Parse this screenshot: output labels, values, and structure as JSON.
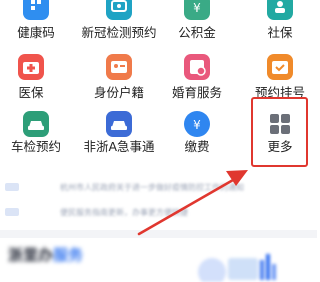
{
  "services": {
    "row1": [
      {
        "label": "健康码",
        "icon": "health-code-icon",
        "color": "#2f8ef0"
      },
      {
        "label": "新冠检测预约",
        "icon": "covid-test-icon",
        "color": "#1fa3c4"
      },
      {
        "label": "公积金",
        "icon": "housing-fund-icon",
        "color": "#3aaa86"
      },
      {
        "label": "社保",
        "icon": "social-security-icon",
        "color": "#22a9a2"
      }
    ],
    "row2": [
      {
        "label": "医保",
        "icon": "medical-insurance-icon",
        "color": "#f0544c"
      },
      {
        "label": "身份户籍",
        "icon": "id-household-icon",
        "color": "#f07a4a"
      },
      {
        "label": "婚育服务",
        "icon": "marriage-birth-icon",
        "color": "#e9587c"
      },
      {
        "label": "预约挂号",
        "icon": "appointment-icon",
        "color": "#f08a2a"
      }
    ],
    "row3": [
      {
        "label": "车检预约",
        "icon": "car-inspection-icon",
        "color": "#2d9e78"
      },
      {
        "label": "非浙A急事通",
        "icon": "non-zhejiang-car-icon",
        "color": "#3c6bd6"
      },
      {
        "label": "缴费",
        "icon": "payment-icon",
        "color": "#2f86f0"
      },
      {
        "label": "更多",
        "icon": "more-grid-icon",
        "color": "#6b6f78"
      }
    ]
  },
  "annotation": {
    "highlight_color": "#e0372f",
    "arrow": "arrow-pointing-to-more"
  },
  "news": [
    {
      "text": "杭州市人民政府关于进一步做好疫情防控工作的通知"
    },
    {
      "text": "便民服务指南更新，办事更方便快捷"
    }
  ],
  "bottom": {
    "title_part1": "浙里办",
    "title_part2": "服务"
  }
}
